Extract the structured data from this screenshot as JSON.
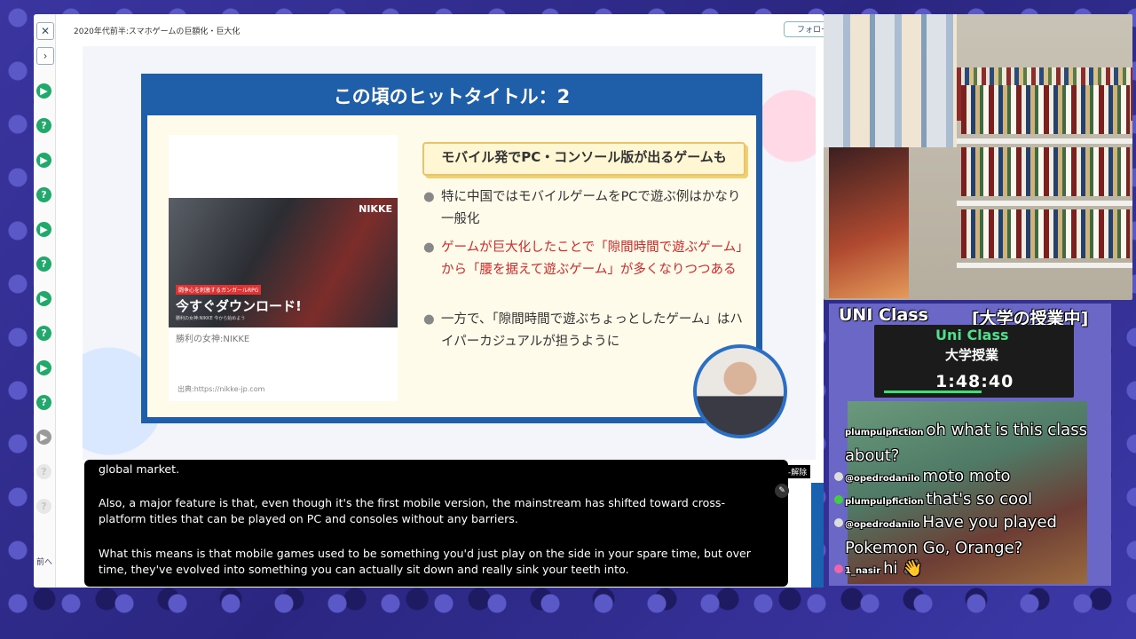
{
  "browser": {
    "title": "2020年代前半:スマホゲームの巨額化・巨大化",
    "follow_label": "フォロー",
    "prev_label": "前へ"
  },
  "slide": {
    "heading": "この頃のヒットタイトル：2",
    "callout": "モバイル発でPC・コンソール版が出るゲームも",
    "bullets": [
      {
        "text": "特に中国ではモバイルゲームをPCで遊ぶ例はかなり一般化",
        "color": "#333333"
      },
      {
        "text": "ゲームが巨大化したことで「隙間時間で遊ぶゲーム」から「腰を据えて遊ぶゲーム」が多くなりつつある",
        "color": "#d12929"
      },
      {
        "text": "一方で、「隙間時間で遊ぶちょっとしたゲーム」はハイパーカジュアルが担うように",
        "color": "#333333"
      }
    ],
    "image_logo": "NIKKE",
    "image_tag": "闘争心を刺激するガンガールRPG",
    "image_cta": "今すぐダウンロード!",
    "image_sub": "勝利の女神:NIKKE 今から始めよう",
    "image_caption": "勝利の女神:NIKKE",
    "image_source": "出典:https://nikke-jp.com"
  },
  "captions": {
    "close_label": "-解除",
    "line1": "global market.",
    "line2": "Also, a major feature is that, even though it's the first mobile version, the mainstream has shifted toward cross-platform titles that can be played on PC and consoles without any barriers.",
    "line3": "What this means is that mobile games used to be something you'd just play on the side in your spare time, but over time, they've evolved into something you can actually sit down and really sink your teeth into."
  },
  "stream": {
    "title": "UNI Class",
    "title_right": "[大学の授業中]",
    "timer_label": "Uni Class",
    "timer_sublabel": "大学授業",
    "timer": "1:48:40"
  },
  "chat": [
    {
      "user": "plumpulpfiction",
      "text": "oh what is this class about?"
    },
    {
      "user": "@opedrodanilo",
      "text": "moto moto"
    },
    {
      "user": "plumpulpfiction",
      "text": "that's so cool"
    },
    {
      "user": "@opedrodanilo",
      "text": "Have you played Pokemon Go, Orange?"
    },
    {
      "user": "1_nasir",
      "text": "hi 👋"
    }
  ],
  "colors": {
    "accent": "#1f5ea8",
    "status_green": "#21a96b",
    "chat_text": "#ffffff"
  }
}
